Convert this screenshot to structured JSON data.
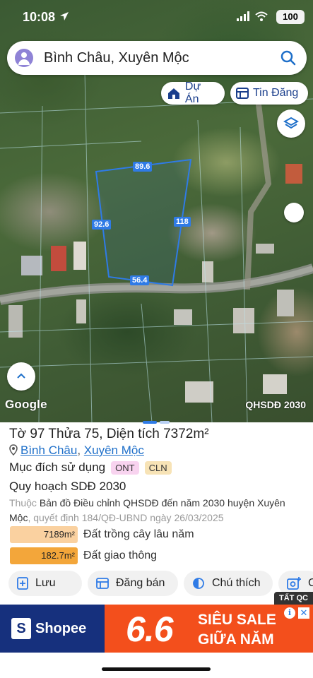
{
  "status_bar": {
    "time": "10:08",
    "battery": "100"
  },
  "search": {
    "query": "Bình Châu, Xuyên Mộc"
  },
  "chips": {
    "du_an": "Dự Án",
    "tin_dang": "Tin Đăng"
  },
  "map": {
    "attribution": "Google",
    "layer_label": "QHSDĐ 2030",
    "dimensions": {
      "top": "89.6",
      "left": "92.6",
      "right": "118",
      "bottom": "56.4"
    }
  },
  "parcel": {
    "title": "Tờ 97 Thửa 75, Diện tích 7372m²",
    "ward": "Bình Châu",
    "separator": ", ",
    "district": "Xuyên Mộc",
    "purpose_label": "Mục đích sử dụng",
    "purpose_tags": [
      "ONT",
      "CLN"
    ],
    "plan_title": "Quy hoạch SDĐ 2030",
    "desc_prefix": "Thuộc",
    "desc_main": "Bản đồ Điều chỉnh QHSDĐ đến năm 2030 huyện Xuyên Mộc",
    "desc_suffix": ", quyết định 184/QĐ-UBND ngày 26/03/2025",
    "areas": [
      {
        "value": "7189m²",
        "label": "Đất trồng cây lâu năm",
        "color": "#fad1a0"
      },
      {
        "value": "182.7m²",
        "label": "Đất giao thông",
        "color": "#f3a63a"
      }
    ]
  },
  "actions": {
    "luu": "Lưu",
    "dang_ban": "Đăng bán",
    "chu_thich": "Chú thích",
    "more": "C"
  },
  "ad": {
    "badge": "TẤT QC",
    "brand": "Shopee",
    "big": "6.6",
    "line1": "SIÊU SALE",
    "line2": "GIỮA NĂM"
  },
  "colors": {
    "accent": "#2f7be6",
    "link": "#1e6fc9",
    "chip_text": "#1a3e8c"
  }
}
